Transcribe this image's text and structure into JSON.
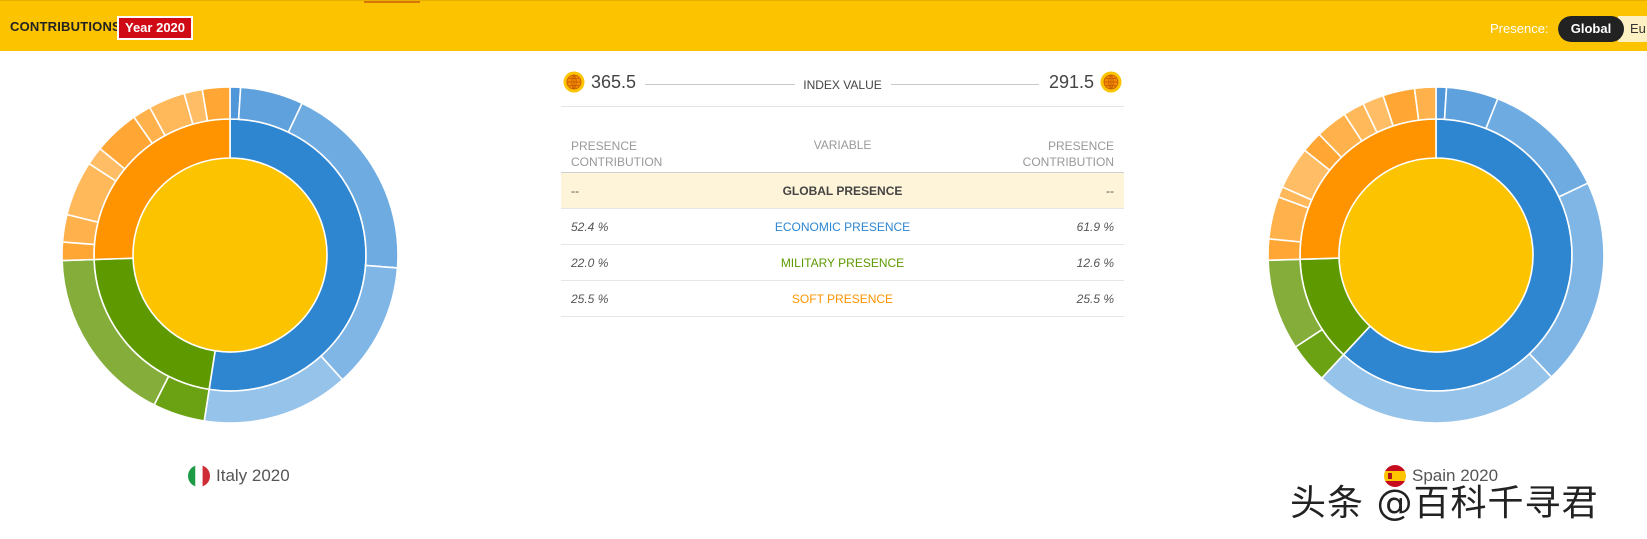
{
  "header": {
    "title": "CONTRIBUTIONS",
    "year_badge": "Year 2020",
    "presence_label": "Presence:",
    "presence_options": [
      "Global",
      "Eu"
    ],
    "presence_selected": "Global"
  },
  "colors": {
    "header_bg": "#fcc300",
    "badge_bg": "#cf0a15",
    "global": "#fcc300",
    "economic": "#2e86d1",
    "military": "#5e9900",
    "soft": "#ff9400"
  },
  "left_country": {
    "label": "Italy 2020",
    "flag": "italy-flag-icon"
  },
  "right_country": {
    "label": "Spain 2020",
    "flag": "spain-flag-icon"
  },
  "index": {
    "left_value": "365.5",
    "right_value": "291.5",
    "label": "INDEX VALUE"
  },
  "table": {
    "headers": {
      "left": [
        "PRESENCE",
        "CONTRIBUTION"
      ],
      "middle": "VARIABLE",
      "right": [
        "PRESENCE",
        "CONTRIBUTION"
      ]
    },
    "rows": [
      {
        "left": "--",
        "variable": "GLOBAL PRESENCE",
        "right": "--",
        "color": "#444444"
      },
      {
        "left": "52.4 %",
        "variable": "ECONOMIC PRESENCE",
        "right": "61.9 %",
        "color": "#2e86d1"
      },
      {
        "left": "22.0 %",
        "variable": "MILITARY PRESENCE",
        "right": "12.6 %",
        "color": "#5e9900"
      },
      {
        "left": "25.5 %",
        "variable": "SOFT PRESENCE",
        "right": "25.5 %",
        "color": "#ff9400"
      }
    ]
  },
  "chart_data": [
    {
      "type": "pie",
      "country": "Italy 2020",
      "center": "Global presence",
      "inner": [
        {
          "name": "Economic presence",
          "value": 52.4
        },
        {
          "name": "Military presence",
          "value": 22.0
        },
        {
          "name": "Soft presence",
          "value": 25.5
        }
      ],
      "outer": [
        {
          "group": "Economic presence",
          "values": [
            1,
            6,
            19,
            12,
            14
          ]
        },
        {
          "group": "Military presence",
          "values": [
            5,
            17
          ]
        },
        {
          "group": "Soft presence",
          "values": [
            2,
            3,
            6,
            2,
            5,
            2,
            4,
            2,
            3
          ]
        }
      ]
    },
    {
      "type": "pie",
      "country": "Spain 2020",
      "center": "Global presence",
      "inner": [
        {
          "name": "Economic presence",
          "value": 61.9
        },
        {
          "name": "Military presence",
          "value": 12.6
        },
        {
          "name": "Soft presence",
          "value": 25.5
        }
      ],
      "outer": [
        {
          "group": "Economic presence",
          "values": [
            1,
            5,
            12,
            20,
            24
          ]
        },
        {
          "group": "Military presence",
          "values": [
            4,
            9
          ]
        },
        {
          "group": "Soft presence",
          "values": [
            2,
            4,
            1,
            4,
            2,
            3,
            2,
            2,
            3,
            2
          ]
        }
      ]
    }
  ],
  "watermark": "头条 @百科千寻君"
}
